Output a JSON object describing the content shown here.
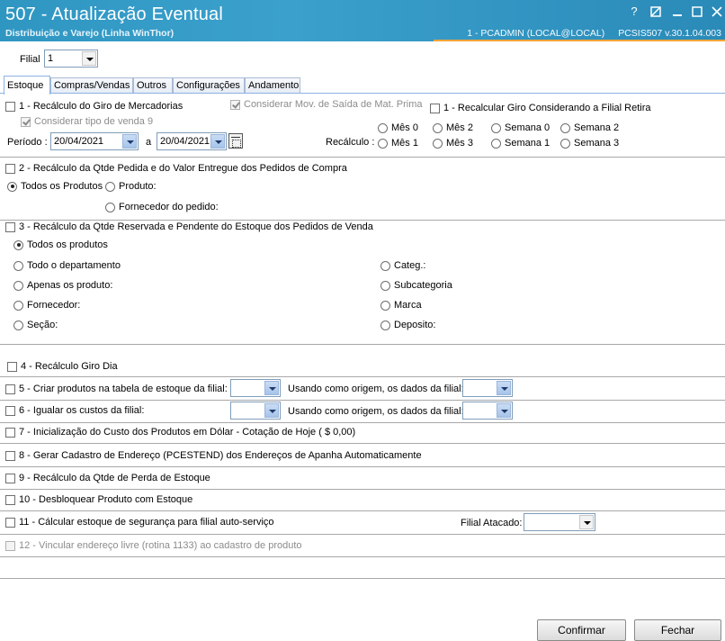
{
  "window": {
    "title": "507 - Atualização Eventual",
    "subtitle": "Distribuição e Varejo (Linha WinThor)",
    "user_info": "1 - PCADMIN (LOCAL@LOCAL)",
    "program_info": "PCSIS507  v.30.1.04.003"
  },
  "header": {
    "filial_label": "Filial",
    "filial_value": "1"
  },
  "tabs": [
    {
      "label": "Estoque",
      "active": true
    },
    {
      "label": "Compras/Vendas"
    },
    {
      "label": "Outros"
    },
    {
      "label": "Configurações"
    },
    {
      "label": "Andamento"
    }
  ],
  "sec1": {
    "label": "1 - Recálculo do Giro de Mercadorias",
    "considerar_mov": "Considerar Mov. de Saída de Mat. Prima",
    "recalcular_filial": "1 - Recalcular Giro Considerando a Filial Retira",
    "considerar_tipo": "Considerar tipo de venda 9",
    "periodo_label": "Período :",
    "date_from": "20/04/2021",
    "date_sep": "a",
    "date_to": "20/04/2021",
    "recalculo_label": "Recálculo :",
    "options": [
      "Mês 0",
      "Mês 2",
      "Semana 0",
      "Semana 2",
      "Mês 1",
      "Mês 3",
      "Semana 1",
      "Semana 3"
    ]
  },
  "sec2": {
    "label": "2 - Recálculo da Qtde Pedida e do Valor Entregue dos Pedidos de Compra",
    "opt_todos": "Todos os Produtos",
    "opt_produto": "Produto:",
    "opt_fornecedor": "Fornecedor do pedido:"
  },
  "sec3": {
    "label": "3 - Recálculo da Qtde Reservada e Pendente do Estoque dos Pedidos de Venda",
    "left": [
      "Todos os produtos",
      "Todo o departamento",
      "Apenas os produto:",
      "Fornecedor:",
      "Seção:"
    ],
    "right": [
      "Categ.:",
      "Subcategoria",
      "Marca",
      "Deposito:"
    ]
  },
  "sec4": {
    "label": "4 - Recálculo Giro Dia"
  },
  "sec5": {
    "label": "5 - Criar produtos na tabela de estoque da filial:",
    "origem": "Usando como origem, os dados da filial:"
  },
  "sec6": {
    "label": "6 - Igualar os custos da filial:",
    "origem": "Usando como origem, os dados da filial:"
  },
  "sec7": {
    "label": "7 - Inicialização do Custo dos Produtos em Dólar - Cotação de Hoje ( $ 0,00)"
  },
  "sec8": {
    "label": "8 - Gerar Cadastro de Endereço (PCESTEND) dos Endereços de Apanha Automaticamente"
  },
  "sec9": {
    "label": "9 - Recálculo da Qtde de Perda de Estoque"
  },
  "sec10": {
    "label": "10 - Desbloquear Produto com Estoque"
  },
  "sec11": {
    "label": "11 - Cálcular estoque de segurança para filial auto-serviço",
    "filial_atacado": "Filial Atacado:"
  },
  "sec12": {
    "label": "12 - Vincular endereço livre (rotina 1133) ao cadastro de produto"
  },
  "buttons": {
    "confirmar": "Confirmar",
    "fechar": "Fechar"
  },
  "colors": {
    "titlebar": "#3ba0cc",
    "accent_line": "#f3a53a",
    "tab_border": "#8db2e3"
  }
}
